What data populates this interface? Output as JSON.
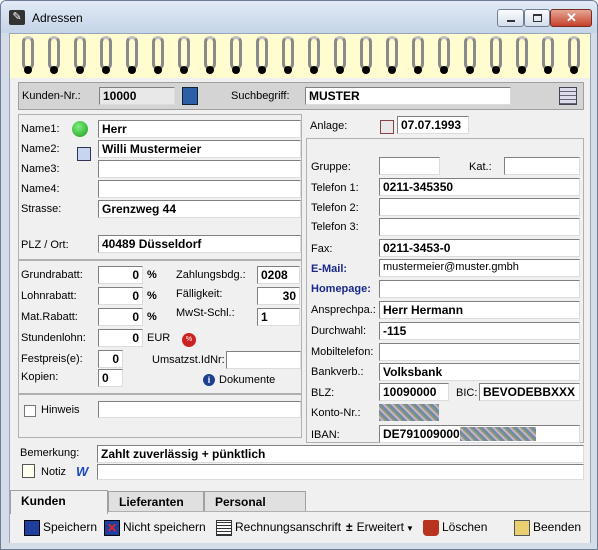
{
  "window": {
    "title": "Adressen"
  },
  "header": {
    "kunden_nr_label": "Kunden-Nr.:",
    "kunden_nr_value": "10000",
    "suchbegriff_label": "Suchbegriff:",
    "suchbegriff_value": "MUSTER"
  },
  "address": {
    "name1_label": "Name1:",
    "name1_value": "Herr",
    "name2_label": "Name2:",
    "name2_value": "Willi Mustermeier",
    "name3_label": "Name3:",
    "name3_value": "",
    "name4_label": "Name4:",
    "name4_value": "",
    "strasse_label": "Strasse:",
    "strasse_value": "Grenzweg 44",
    "plz_label": "PLZ / Ort:",
    "plz_value": "40489 Düsseldorf"
  },
  "conditions": {
    "grundrabatt_label": "Grundrabatt:",
    "grundrabatt_value": "0",
    "lohnrabatt_label": "Lohnrabatt:",
    "lohnrabatt_value": "0",
    "matrabatt_label": "Mat.Rabatt:",
    "matrabatt_value": "0",
    "percent": "%",
    "stundenlohn_label": "Stundenlohn:",
    "stundenlohn_value": "0",
    "currency": "EUR",
    "festpreise_label": "Festpreis(e):",
    "festpreise_value": "0",
    "kopien_label": "Kopien:",
    "kopien_value": "0",
    "zahlungsbdg_label": "Zahlungsbdg.:",
    "zahlungsbdg_value": "0208",
    "faelligkeit_label": "Fälligkeit:",
    "faelligkeit_value": "30",
    "mwst_label": "MwSt-Schl.:",
    "mwst_value": "1",
    "ustid_label": "Umsatzst.IdNr:",
    "ustid_value": "",
    "dokumente_label": "Dokumente"
  },
  "hinweis": {
    "label": "Hinweis",
    "value": ""
  },
  "contact": {
    "anlage_label": "Anlage:",
    "anlage_value": "07.07.1993",
    "gruppe_label": "Gruppe:",
    "gruppe_value": "",
    "kat_label": "Kat.:",
    "kat_value": "",
    "telefon1_label": "Telefon 1:",
    "telefon1_value": "0211-345350",
    "telefon2_label": "Telefon 2:",
    "telefon2_value": "",
    "telefon3_label": "Telefon 3:",
    "telefon3_value": "",
    "fax_label": "Fax:",
    "fax_value": "0211-3453-0",
    "email_label": "E-Mail:",
    "email_value": "mustermeier@muster.gmbh",
    "homepage_label": "Homepage:",
    "homepage_value": "",
    "ansprechpartner_label": "Ansprechpa.:",
    "ansprechpartner_value": "Herr Hermann",
    "durchwahl_label": "Durchwahl:",
    "durchwahl_value": "-115",
    "mobil_label": "Mobiltelefon:",
    "mobil_value": "",
    "bankverb_label": "Bankverb.:",
    "bankverb_value": "Volksbank",
    "blz_label": "BLZ:",
    "blz_value": "10090000",
    "bic_label": "BIC:",
    "bic_value": "BEVODEBBXXX",
    "konto_label": "Konto-Nr.:",
    "iban_label": "IBAN:",
    "iban_value": "DE791009000"
  },
  "bemerkung": {
    "label": "Bemerkung:",
    "value": "Zahlt zuverlässig + pünktlich",
    "notiz_label": "Notiz",
    "notiz_value": ""
  },
  "tabs": [
    {
      "label": "Kunden",
      "active": true
    },
    {
      "label": "Lieferanten",
      "active": false
    },
    {
      "label": "Personal",
      "active": false
    }
  ],
  "toolbar": {
    "speichern": "Speichern",
    "nicht_speichern": "Nicht speichern",
    "rechnungsanschrift": "Rechnungsanschrift",
    "erweitert": "Erweitert",
    "loeschen": "Löschen",
    "beenden": "Beenden"
  },
  "colors": {
    "accent_link": "#1a2a8c",
    "notepad": "#fffccf"
  }
}
